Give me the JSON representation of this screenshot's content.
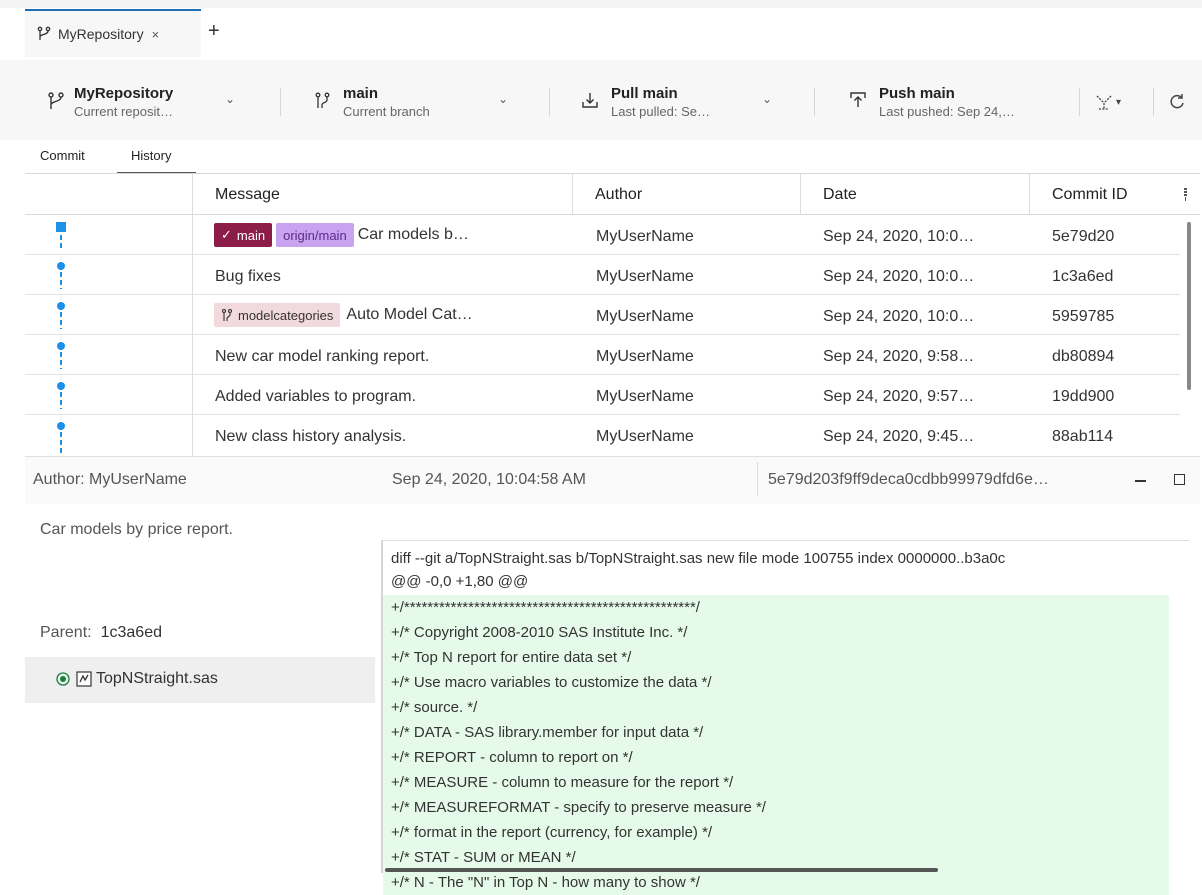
{
  "tabs": [
    {
      "label": "MyRepository",
      "close": "×"
    }
  ],
  "add_tab": "+",
  "toolbar": {
    "repo": {
      "title": "MyRepository",
      "sub": "Current reposit…"
    },
    "branch": {
      "title": "main",
      "sub": "Current branch"
    },
    "pull": {
      "title": "Pull main",
      "sub": "Last pulled: Se…"
    },
    "push": {
      "title": "Push main",
      "sub": "Last pushed: Sep 24,…"
    },
    "chevron": "⌄",
    "more_chevron": "▾"
  },
  "subtabs": [
    "Commit",
    "History"
  ],
  "columns": [
    "Message",
    "Author",
    "Date",
    "Commit ID"
  ],
  "commits": [
    {
      "badges": [
        {
          "text": "main",
          "type": "current"
        },
        {
          "text": "origin/main",
          "type": "remote"
        }
      ],
      "message": "Car models b…",
      "author": "MyUserName",
      "date": "Sep 24, 2020, 10:0…",
      "id": "5e79d20"
    },
    {
      "badges": [],
      "message": "Bug fixes",
      "author": "MyUserName",
      "date": "Sep 24, 2020, 10:0…",
      "id": "1c3a6ed"
    },
    {
      "badges": [
        {
          "text": "modelcategories",
          "type": "branch"
        }
      ],
      "message": "Auto Model Cat…",
      "author": "MyUserName",
      "date": "Sep 24, 2020, 10:0…",
      "id": "5959785"
    },
    {
      "badges": [],
      "message": "New car model ranking report.",
      "author": "MyUserName",
      "date": "Sep 24, 2020, 9:58…",
      "id": "db80894"
    },
    {
      "badges": [],
      "message": "Added variables to program.",
      "author": "MyUserName",
      "date": "Sep 24, 2020, 9:57…",
      "id": "19dd900"
    },
    {
      "badges": [],
      "message": "New class history analysis.",
      "author": "MyUserName",
      "date": "Sep 24, 2020, 9:45…",
      "id": "88ab114"
    }
  ],
  "details": {
    "author": "Author: MyUserName",
    "date": "Sep 24, 2020, 10:04:58 AM",
    "full_id": "5e79d203f9ff9deca0cdbb99979dfd6e…",
    "message": "Car models by price report.",
    "parent_label": "Parent:",
    "parent_id": "1c3a6ed",
    "file": "TopNStraight.sas"
  },
  "diff": {
    "header": "diff --git a/TopNStraight.sas b/TopNStraight.sas new file mode 100755 index 0000000..b3a0c",
    "hunk": "@@ -0,0 +1,80 @@",
    "lines": [
      "+/**************************************************/",
      "+/* Copyright 2008-2010 SAS Institute Inc. */",
      "+/* Top N report for entire data set */",
      "+/* Use macro variables to customize the data */",
      "+/* source. */",
      "+/* DATA - SAS library.member for input data */",
      "+/* REPORT - column to report on */",
      "+/* MEASURE - column to measure for the report */",
      "+/* MEASUREFORMAT - specify to preserve measure */",
      "+/* format in the report (currency, for example) */",
      "+/* STAT - SUM or MEAN */",
      "+/* N - The \"N\" in Top N - how many to show */"
    ]
  },
  "colors": {
    "main_badge": "#8c1c48",
    "origin_badge": "#c9a3f0",
    "branch_badge": "#f1d9dd",
    "graph": "#1e90e8",
    "added_bg": "#e6faea",
    "accent": "#1f6fb5"
  }
}
